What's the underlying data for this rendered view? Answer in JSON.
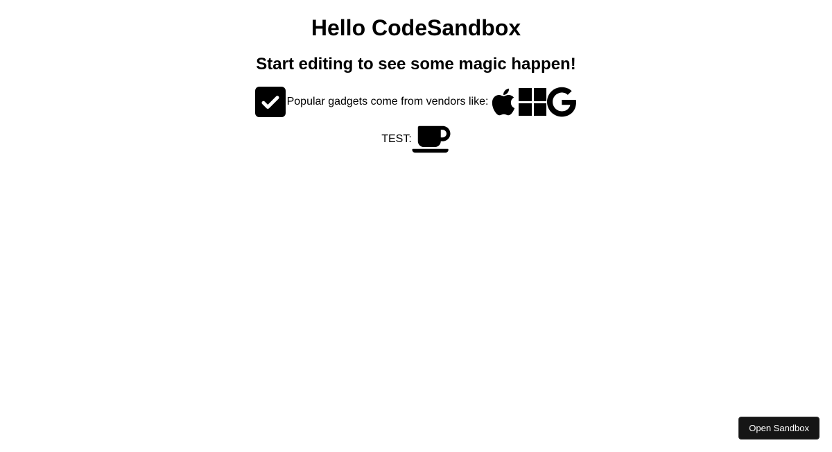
{
  "heading": "Hello CodeSandbox",
  "subheading": "Start editing to see some magic happen!",
  "line1_text": "Popular gadgets come from vendors like:",
  "line2_label": "TEST: ",
  "open_sandbox_label": "Open Sandbox",
  "icons": {
    "check": "check-square-icon",
    "apple": "apple-icon",
    "microsoft": "microsoft-icon",
    "google": "google-icon",
    "coffee": "coffee-icon"
  }
}
